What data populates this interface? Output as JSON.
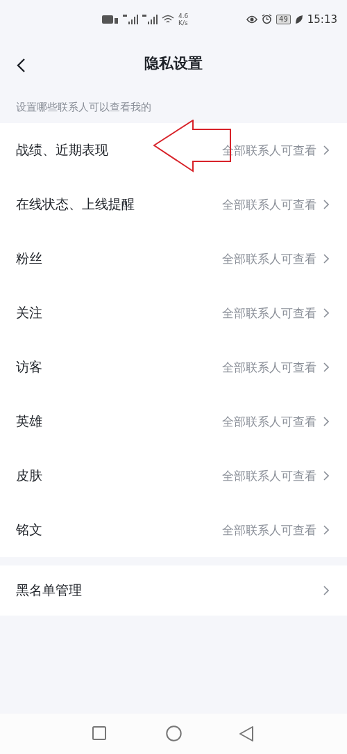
{
  "status_bar": {
    "speed_value": "4.6",
    "speed_unit": "K/s",
    "battery": "49",
    "time": "15:13"
  },
  "header": {
    "title": "隐私设置"
  },
  "section_label": "设置哪些联系人可以查看我的",
  "rows": [
    {
      "label": "战绩、近期表现",
      "value": "全部联系人可查看"
    },
    {
      "label": "在线状态、上线提醒",
      "value": "全部联系人可查看"
    },
    {
      "label": "粉丝",
      "value": "全部联系人可查看"
    },
    {
      "label": "关注",
      "value": "全部联系人可查看"
    },
    {
      "label": "访客",
      "value": "全部联系人可查看"
    },
    {
      "label": "英雄",
      "value": "全部联系人可查看"
    },
    {
      "label": "皮肤",
      "value": "全部联系人可查看"
    },
    {
      "label": "铭文",
      "value": "全部联系人可查看"
    }
  ],
  "blacklist": {
    "label": "黑名单管理"
  }
}
